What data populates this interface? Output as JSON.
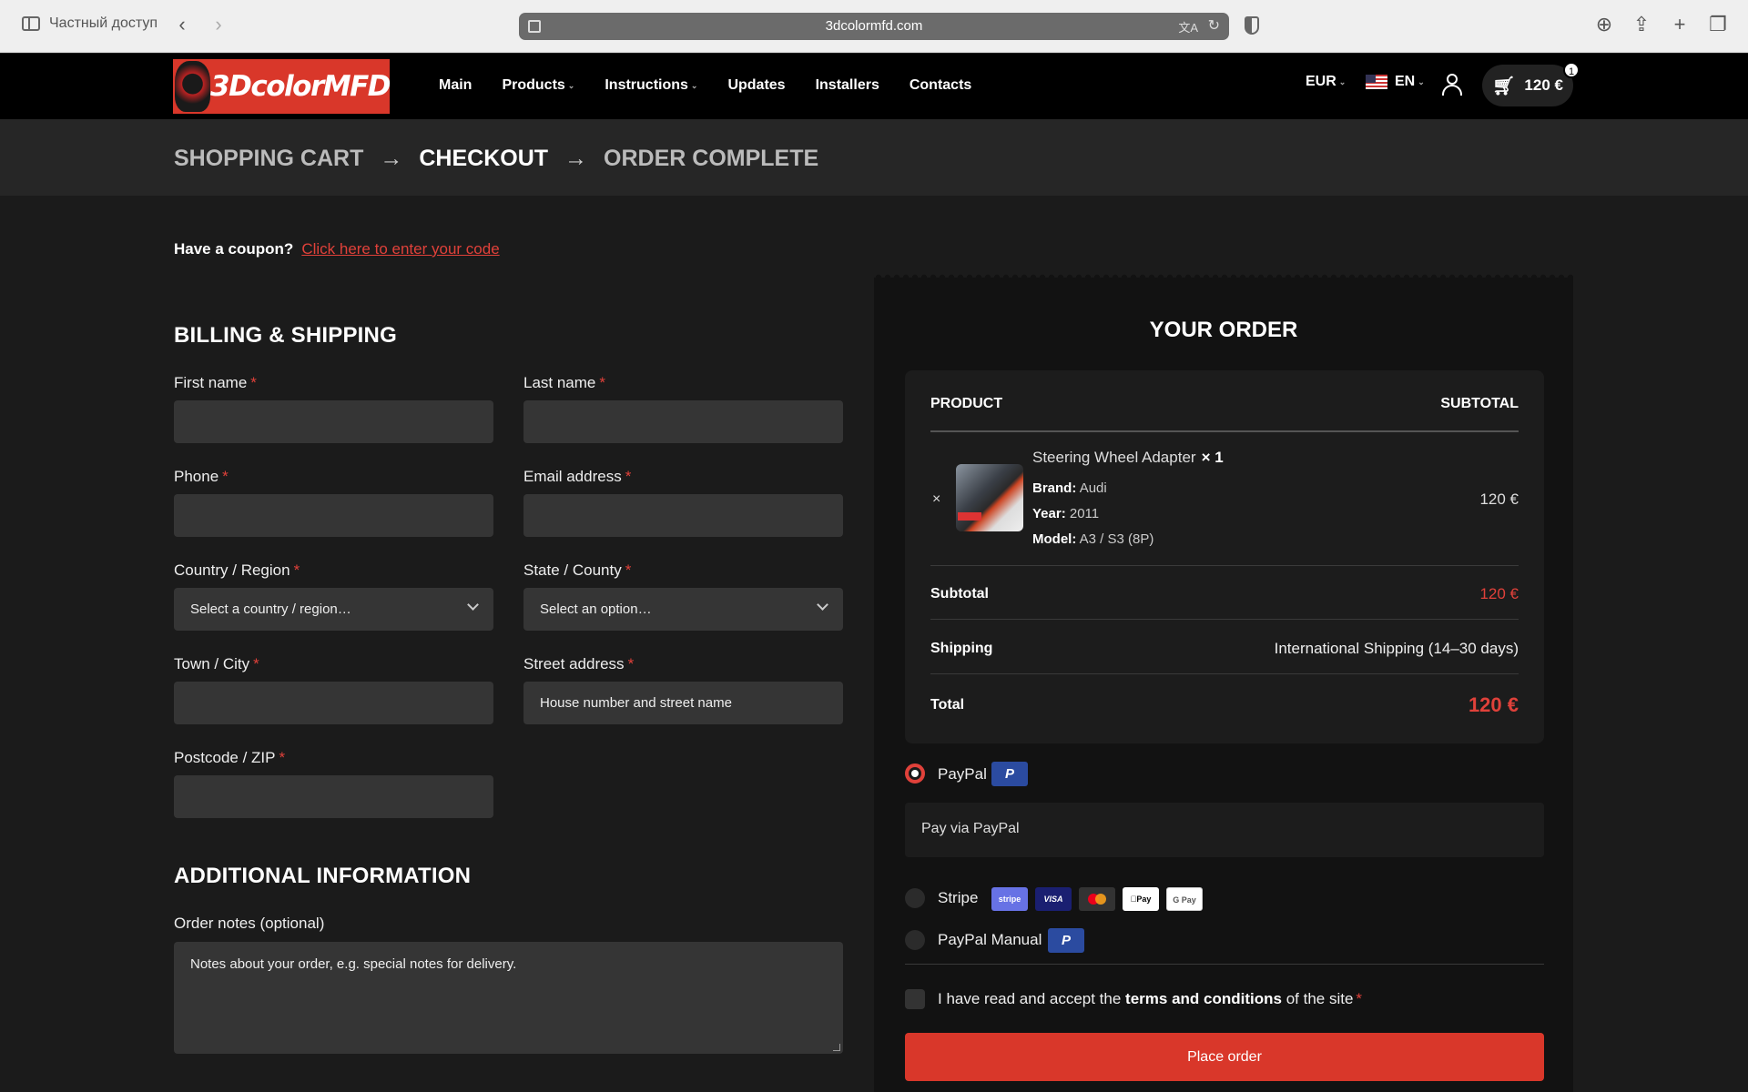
{
  "browser": {
    "private_label": "Частный доступ",
    "url": "3dcolormfd.com"
  },
  "header": {
    "logo_text": "3DcolorMFD",
    "nav": [
      {
        "label": "Main"
      },
      {
        "label": "Products",
        "dropdown": true
      },
      {
        "label": "Instructions",
        "dropdown": true
      },
      {
        "label": "Updates"
      },
      {
        "label": "Installers"
      },
      {
        "label": "Contacts"
      }
    ],
    "currency": "EUR",
    "language": "EN",
    "cart_total": "120 €",
    "cart_count": "1"
  },
  "steps": {
    "cart": "SHOPPING CART",
    "checkout": "CHECKOUT",
    "complete": "ORDER COMPLETE",
    "arrow": "→"
  },
  "coupon": {
    "question": "Have a coupon?",
    "link": "Click here to enter your code"
  },
  "billing": {
    "title": "BILLING & SHIPPING",
    "first_name": "First name",
    "last_name": "Last name",
    "phone": "Phone",
    "email": "Email address",
    "country": "Country / Region",
    "country_placeholder": "Select a country / region…",
    "state": "State / County",
    "state_placeholder": "Select an option…",
    "town": "Town / City",
    "street": "Street address",
    "street_placeholder": "House number and street name",
    "postcode": "Postcode / ZIP",
    "required_mark": "*"
  },
  "additional": {
    "title": "ADDITIONAL INFORMATION",
    "notes_label": "Order notes (optional)",
    "notes_placeholder": "Notes about your order, e.g. special notes for delivery."
  },
  "order": {
    "title": "YOUR ORDER",
    "col_product": "PRODUCT",
    "col_subtotal": "SUBTOTAL",
    "remove": "×",
    "item": {
      "name": "Steering Wheel Adapter",
      "qty": "× 1",
      "brand_label": "Brand:",
      "brand": "Audi",
      "year_label": "Year:",
      "year": "2011",
      "model_label": "Model:",
      "model": "A3 / S3 (8P)",
      "price": "120 €"
    },
    "subtotal_label": "Subtotal",
    "subtotal": "120 €",
    "shipping_label": "Shipping",
    "shipping": "International Shipping (14–30 days)",
    "total_label": "Total",
    "total": "120 €"
  },
  "payment": {
    "paypal": "PayPal",
    "paypal_desc": "Pay via PayPal",
    "stripe": "Stripe",
    "paypal_manual": "PayPal Manual",
    "cards": {
      "stripe": "stripe",
      "visa": "VISA",
      "apple": "Pay",
      "google": "G Pay"
    },
    "pp_glyph": "P"
  },
  "terms": {
    "before": "I have read and accept the",
    "link": "terms and conditions",
    "after": "of the site"
  },
  "place_order": "Place order",
  "colors": {
    "accent": "#e0413a",
    "button": "#d9372a",
    "paypal": "#2b4ba0"
  }
}
